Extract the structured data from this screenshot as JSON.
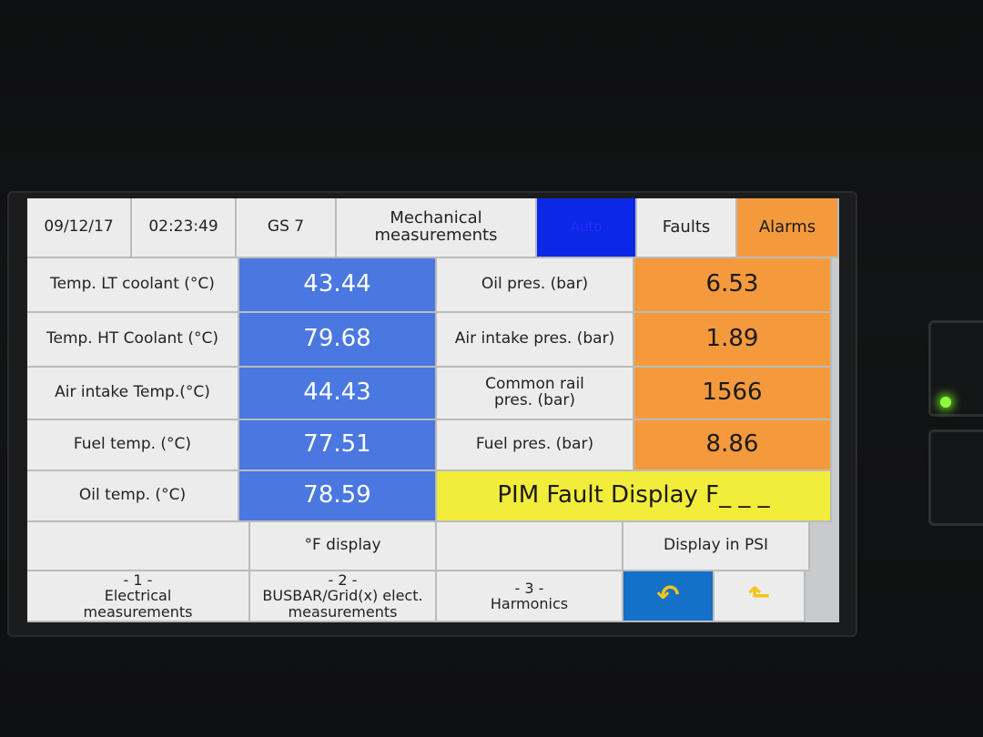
{
  "header": {
    "date": "09/12/17",
    "time": "02:23:49",
    "unit": "GS 7",
    "page_title": "Mechanical measurements",
    "mode": "Auto",
    "faults_label": "Faults",
    "alarms_label": "Alarms"
  },
  "rows": [
    {
      "left_label": "Temp. LT coolant (°C)",
      "left_value": "43.44",
      "right_label": "Oil pres. (bar)",
      "right_value": "6.53"
    },
    {
      "left_label": "Temp. HT Coolant (°C)",
      "left_value": "79.68",
      "right_label": "Air intake pres. (bar)",
      "right_value": "1.89"
    },
    {
      "left_label": "Air intake Temp.(°C)",
      "left_value": "44.43",
      "right_label": "Common rail pres. (bar)",
      "right_value": "1566"
    },
    {
      "left_label": "Fuel temp. (°C)",
      "left_value": "77.51",
      "right_label": "Fuel pres. (bar)",
      "right_value": "8.86"
    },
    {
      "left_label": "Oil temp. (°C)",
      "left_value": "78.59"
    }
  ],
  "fault_display": "PIM Fault Display F_ _ _",
  "buttons": {
    "fahrenheit": "°F display",
    "psi": "Display in PSI"
  },
  "nav": {
    "item1_num": "- 1 -",
    "item1_label": "Electrical measurements",
    "item2_num": "- 2 -",
    "item2_label": "BUSBAR/Grid(x) elect. measurements",
    "item3_num": "- 3 -",
    "item3_label": "Harmonics",
    "back_glyph": "↶",
    "up_glyph": "⬑"
  },
  "colors": {
    "value_blue": "#4a78e0",
    "value_orange": "#f59a3c",
    "fault_yellow": "#f2ec3a",
    "auto_blue": "#0a28e6"
  }
}
